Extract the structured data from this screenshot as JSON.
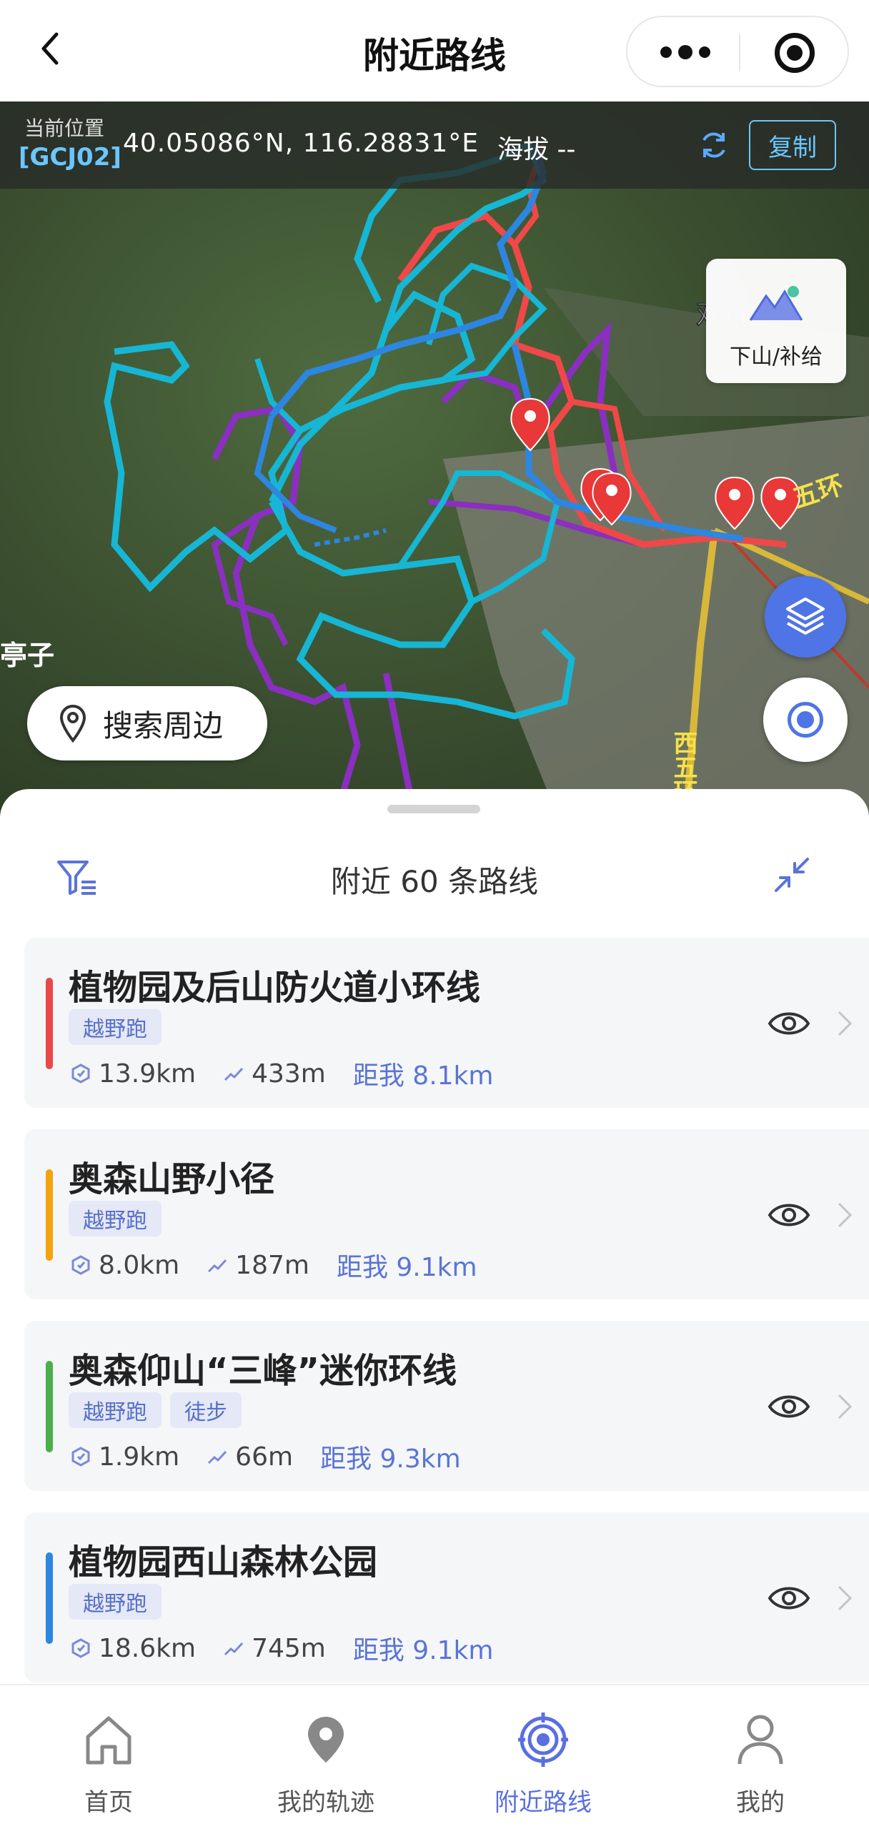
{
  "header": {
    "title": "附近路线"
  },
  "location": {
    "label": "当前位置",
    "coord_system": "[GCJ02]",
    "coords": "40.05086°N, 116.28831°E",
    "altitude": "海拔 --",
    "copy_label": "复制"
  },
  "map": {
    "supply_label": "下山/补给",
    "search_nearby_label": "搜索周边",
    "place_labels": [
      "双石",
      "五环",
      "亭子",
      "西五环"
    ]
  },
  "sheet": {
    "title": "附近 60 条路线",
    "routes": [
      {
        "name": "植物园及后山防火道小环线",
        "tags": [
          "越野跑"
        ],
        "distance": "13.9km",
        "elevation": "433m",
        "from_me": "距我 8.1km",
        "color": "#e84848"
      },
      {
        "name": "奥森山野小径",
        "tags": [
          "越野跑"
        ],
        "distance": "8.0km",
        "elevation": "187m",
        "from_me": "距我 9.1km",
        "color": "#f2a30f"
      },
      {
        "name": "奥森仰山“三峰”迷你环线",
        "tags": [
          "越野跑",
          "徒步"
        ],
        "distance": "1.9km",
        "elevation": "66m",
        "from_me": "距我 9.3km",
        "color": "#4cae4c"
      },
      {
        "name": "植物园西山森林公园",
        "tags": [
          "越野跑"
        ],
        "distance": "18.6km",
        "elevation": "745m",
        "from_me": "距我 9.1km",
        "color": "#2d86e0"
      }
    ]
  },
  "tabbar": {
    "tabs": [
      {
        "label": "首页",
        "icon": "home-icon"
      },
      {
        "label": "我的轨迹",
        "icon": "location-pin-icon"
      },
      {
        "label": "附近路线",
        "icon": "target-icon",
        "active": true
      },
      {
        "label": "我的",
        "icon": "user-icon"
      }
    ]
  }
}
